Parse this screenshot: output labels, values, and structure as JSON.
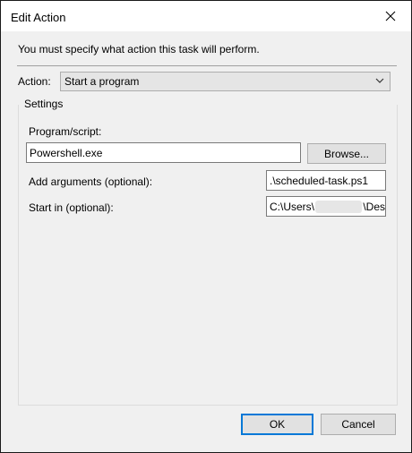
{
  "window": {
    "title": "Edit Action",
    "close_glyph": "×"
  },
  "instruction": "You must specify what action this task will perform.",
  "action": {
    "label": "Action:",
    "selected": "Start a program"
  },
  "settings": {
    "label": "Settings",
    "program_label": "Program/script:",
    "program_value": "Powershell.exe",
    "browse_label": "Browse...",
    "arguments_label": "Add arguments (optional):",
    "arguments_value": ".\\scheduled-task.ps1",
    "start_in_label": "Start in (optional):",
    "start_in_prefix": "C:\\Users\\",
    "start_in_suffix": "\\Des"
  },
  "buttons": {
    "ok": "OK",
    "cancel": "Cancel"
  },
  "icons": {
    "close": "close-icon",
    "dropdown": "chevron-down-icon"
  }
}
